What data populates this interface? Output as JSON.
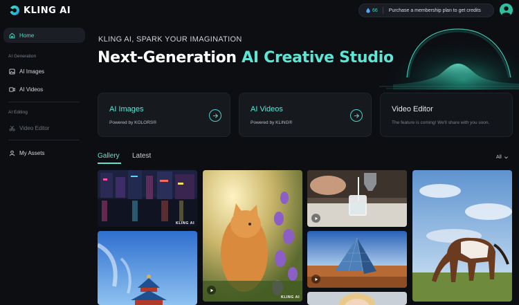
{
  "app": {
    "logo_text": "KLING AI"
  },
  "topbar": {
    "credits_count": "66",
    "credits_message": "Purchase a membership plan to get credits",
    "accent": "#4fd1c5"
  },
  "sidebar": {
    "home": "Home",
    "section_generation": "AI Generation",
    "ai_images": "AI Images",
    "ai_videos": "AI Videos",
    "section_editing": "AI Editing",
    "video_editor": "Video Editor",
    "my_assets": "My Assets"
  },
  "hero": {
    "tagline": "KLING AI, SPARK YOUR IMAGINATION",
    "title_white": "Next-Generation ",
    "title_accent": "AI Creative Studio"
  },
  "cards": [
    {
      "title": "AI Images",
      "subtitle": "Powered by KOLORS®",
      "icon": "arrow-right-circle-icon"
    },
    {
      "title": "AI Videos",
      "subtitle": "Powered by KLING®",
      "icon": "arrow-right-circle-icon"
    },
    {
      "title": "Video Editor",
      "subtitle": "The feature is coming! We'll share with you soon."
    }
  ],
  "tabs": {
    "gallery": "Gallery",
    "latest": "Latest",
    "filter": "All"
  },
  "gallery": {
    "watermark": "KLING AI",
    "items": [
      {
        "subject": "neon city street at night with reflections"
      },
      {
        "subject": "orange kitten among purple flowers",
        "type": "video"
      },
      {
        "subject": "pouring water into a glass",
        "type": "video"
      },
      {
        "subject": "pinto horse grazing on grass under blue sky"
      },
      {
        "subject": "temple of heaven under blue sky"
      },
      {
        "subject": "glass pyramid in desert",
        "type": "video"
      },
      {
        "subject": "portrait with blonde hair"
      }
    ]
  }
}
